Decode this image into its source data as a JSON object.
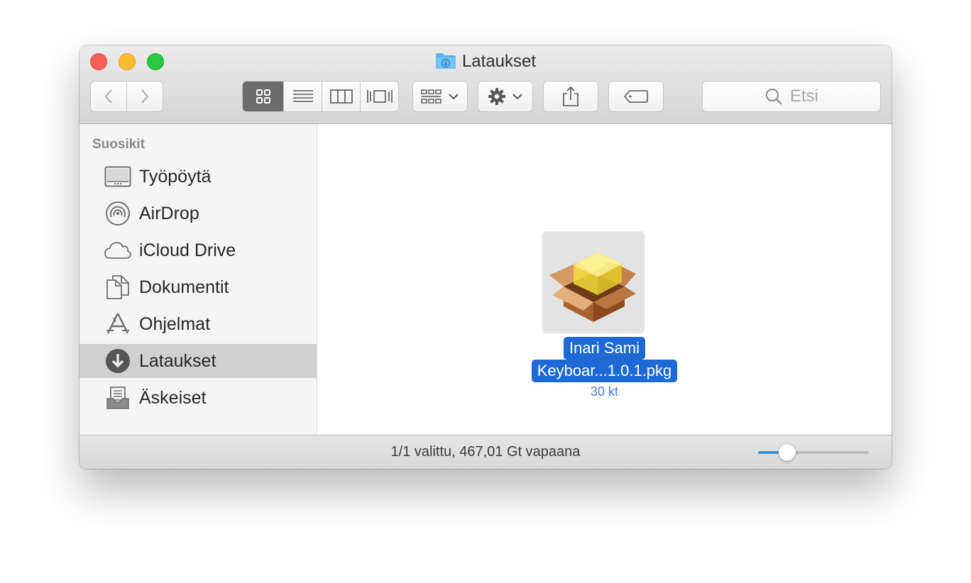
{
  "window": {
    "title": "Lataukset"
  },
  "toolbar": {
    "back_icon": "chevron-left-icon",
    "forward_icon": "chevron-right-icon",
    "view_modes": [
      "icon-view",
      "list-view",
      "column-view",
      "cover-flow-view"
    ],
    "active_view": "icon-view",
    "search_placeholder": "Etsi"
  },
  "sidebar": {
    "heading": "Suosikit",
    "items": [
      {
        "label": "Työpöytä",
        "icon": "desktop-icon",
        "selected": false
      },
      {
        "label": "AirDrop",
        "icon": "airdrop-icon",
        "selected": false
      },
      {
        "label": "iCloud Drive",
        "icon": "cloud-icon",
        "selected": false
      },
      {
        "label": "Dokumentit",
        "icon": "documents-icon",
        "selected": false
      },
      {
        "label": "Ohjelmat",
        "icon": "applications-icon",
        "selected": false
      },
      {
        "label": "Lataukset",
        "icon": "downloads-icon",
        "selected": true
      },
      {
        "label": "Äskeiset",
        "icon": "recents-icon",
        "selected": false
      }
    ]
  },
  "content": {
    "file": {
      "name_line1": "Inari Sami",
      "name_line2": "Keyboar...1.0.1.pkg",
      "size": "30 kt",
      "icon": "package-icon",
      "selected": true
    }
  },
  "statusbar": {
    "text": "1/1 valittu, 467,01 Gt vapaana",
    "icon_size_fraction": 0.26
  },
  "colors": {
    "selection_blue": "#1d6ad7",
    "sidebar_selected": "#d0d0d0",
    "close": "#fc5f57",
    "minimize": "#fdbc2e",
    "maximize": "#28c840"
  }
}
